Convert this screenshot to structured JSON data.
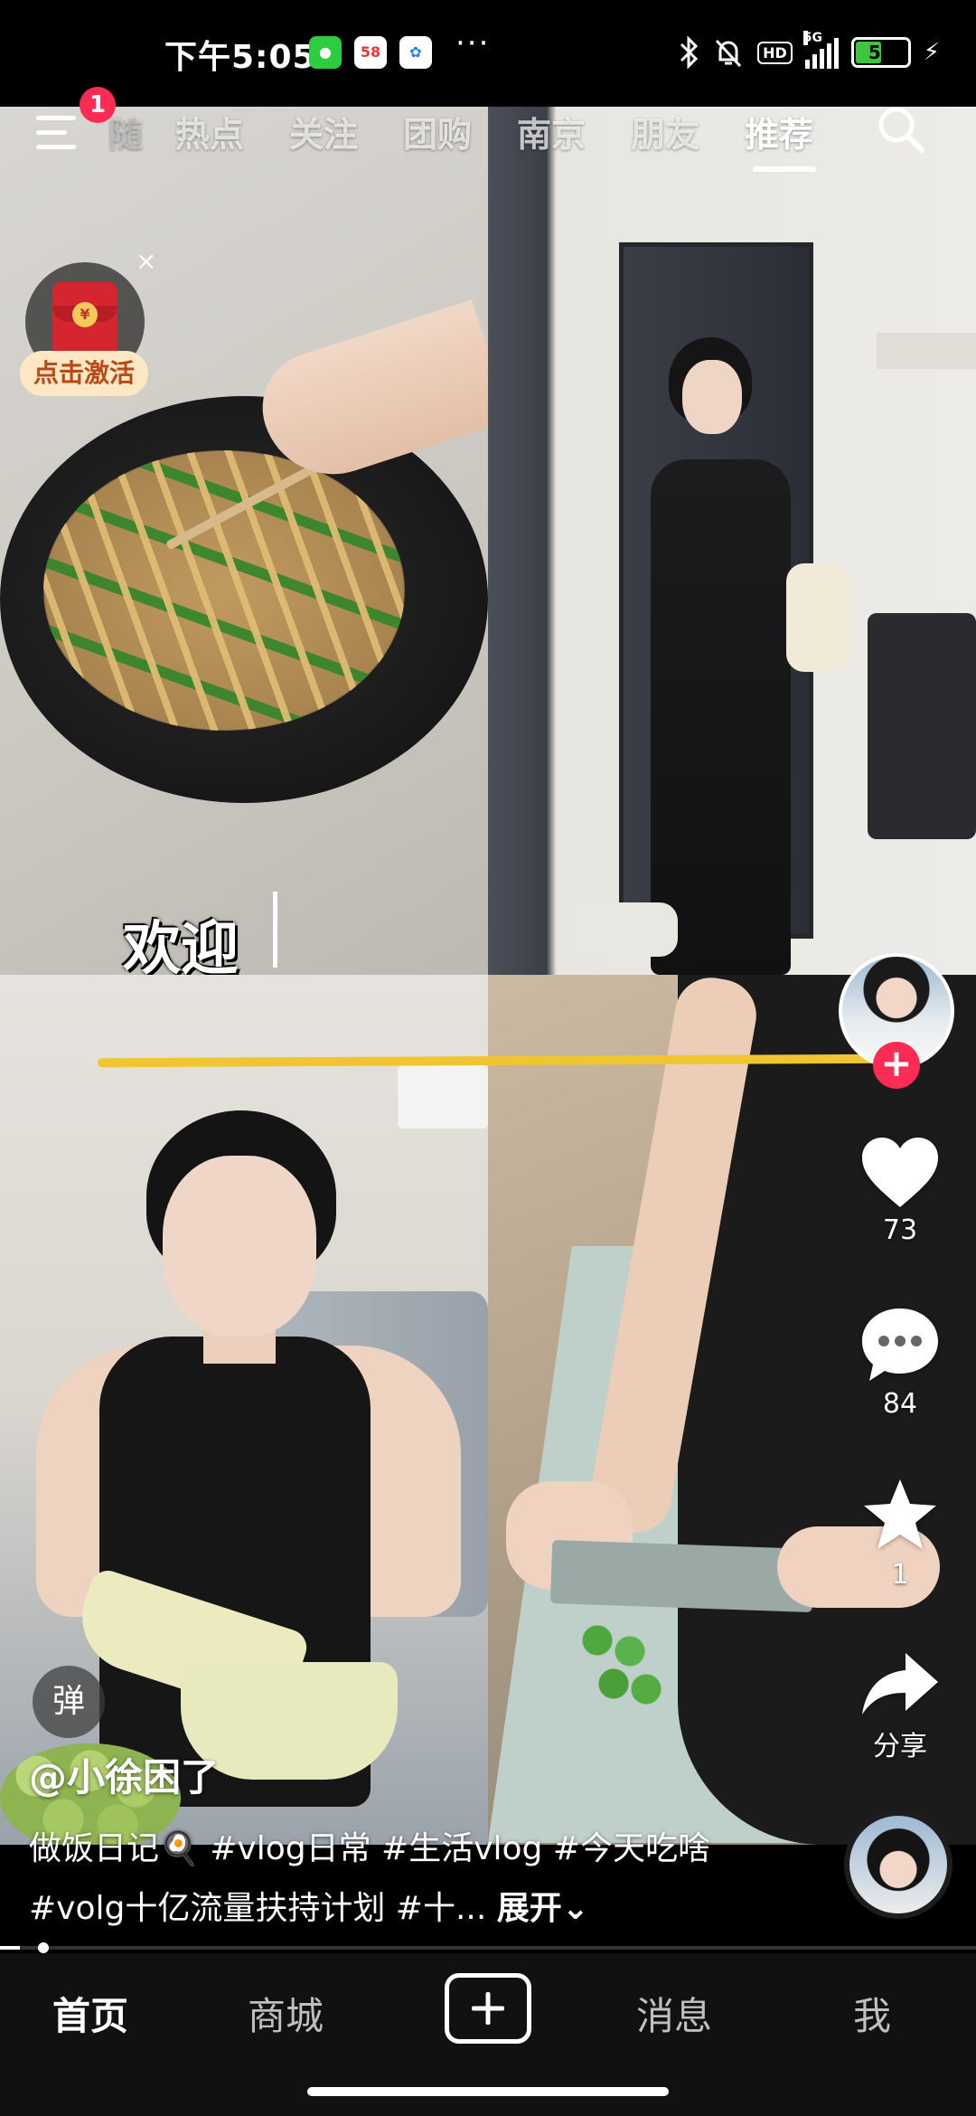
{
  "status_bar": {
    "time": "下午5:05",
    "app_icons": [
      "wechat-icon",
      "58-app-icon",
      "cloud-app-icon"
    ],
    "more": "···",
    "network": "5G",
    "hd": "HD",
    "battery": "54",
    "battery_level": 0.54
  },
  "top_nav": {
    "notification_count": "1",
    "tabs": [
      {
        "label": "热点"
      },
      {
        "label": "关注"
      },
      {
        "label": "团购"
      },
      {
        "label": "南京"
      },
      {
        "label": "朋友"
      },
      {
        "label": "推荐"
      }
    ],
    "partial_tab": "随",
    "active_tab": "推荐"
  },
  "red_packet": {
    "label": "点击激活",
    "close": "×",
    "coin": "¥"
  },
  "video": {
    "overlay_text": "欢迎"
  },
  "actions": {
    "likes": "73",
    "comments": "84",
    "favorites": "1",
    "share": "分享"
  },
  "caption": {
    "danmu": "弹",
    "author": "@小徐困了",
    "text": "做饭日记🍳 #vlog日常 #生活vlog #今天吃啥 #volg十亿流量扶持计划 #十...",
    "expand": "展开",
    "progress": 0.02
  },
  "bottom_nav": {
    "items": [
      "首页",
      "商城",
      "消息",
      "我"
    ],
    "active": "首页"
  },
  "colors": {
    "accent": "#fe2c55",
    "battery": "#3ec53e",
    "highlight_line": "#f1c531"
  }
}
